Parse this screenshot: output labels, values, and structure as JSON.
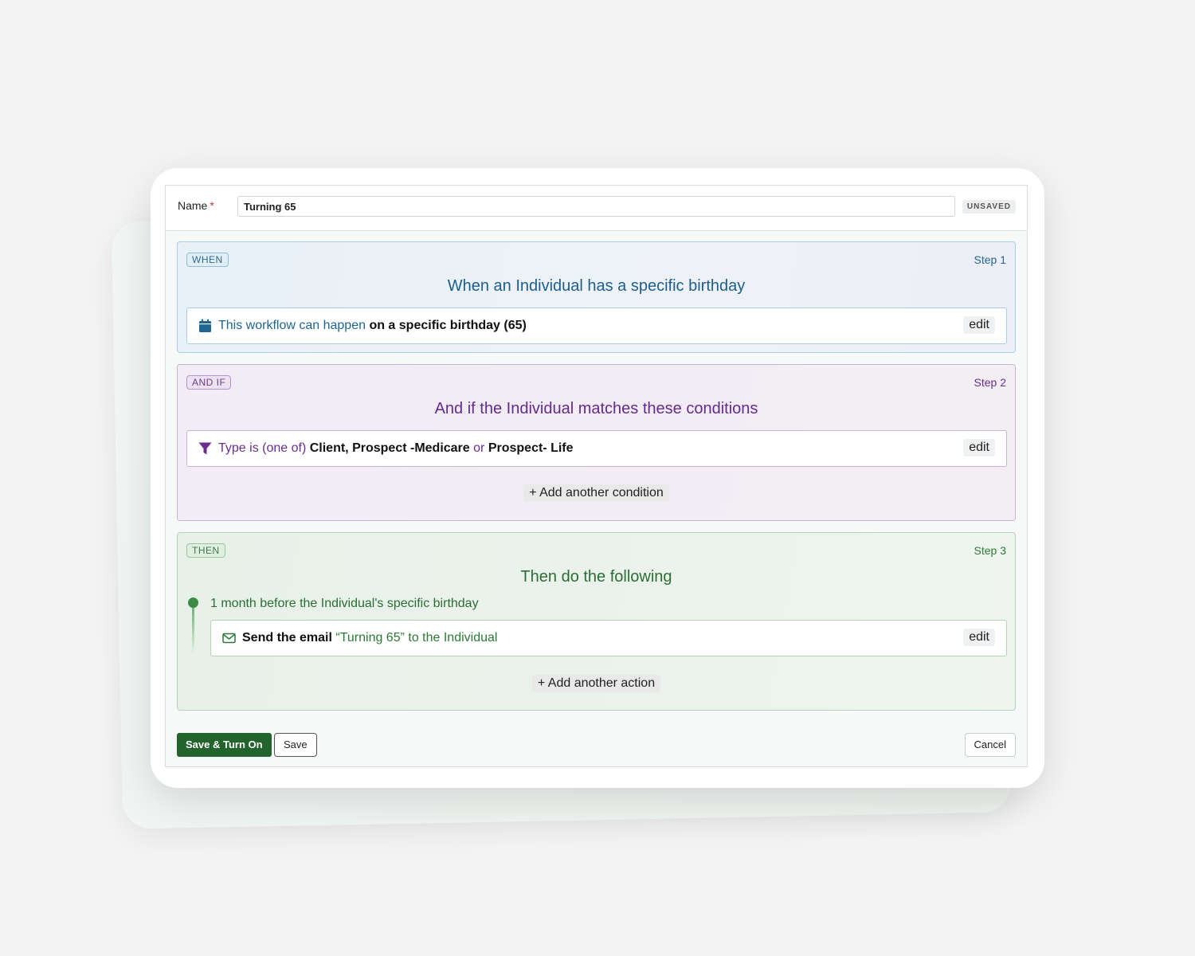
{
  "header": {
    "name_label": "Name",
    "required_mark": "*",
    "name_value": "Turning 65",
    "status_badge": "UNSAVED"
  },
  "steps": [
    {
      "tag": "WHEN",
      "step_label": "Step 1",
      "title": "When an Individual has a specific birthday",
      "rule": {
        "icon": "calendar-icon",
        "pre": "This workflow can happen",
        "bold": "on a specific birthday (65)",
        "edit_label": "edit"
      },
      "color": "#1c5f8c"
    },
    {
      "tag": "AND IF",
      "step_label": "Step 2",
      "title": "And if the Individual matches these conditions",
      "rule": {
        "icon": "filter-icon",
        "pre": "Type is (one of)",
        "bold1": "Client, Prospect -Medicare",
        "mid": "or",
        "bold2": "Prospect- Life",
        "edit_label": "edit"
      },
      "add_label": "+ Add another condition",
      "color": "#652a8c"
    },
    {
      "tag": "THEN",
      "step_label": "Step 3",
      "title": "Then do the following",
      "timeline_text": "1 month before the Individual's specific birthday",
      "rule": {
        "icon": "envelope-icon",
        "bold": "Send the email",
        "post": "“Turning 65” to the Individual",
        "edit_label": "edit"
      },
      "add_label": "+ Add another action",
      "color": "#2b6e35"
    }
  ],
  "footer": {
    "save_turn_on_label": "Save & Turn On",
    "save_label": "Save",
    "cancel_label": "Cancel"
  }
}
